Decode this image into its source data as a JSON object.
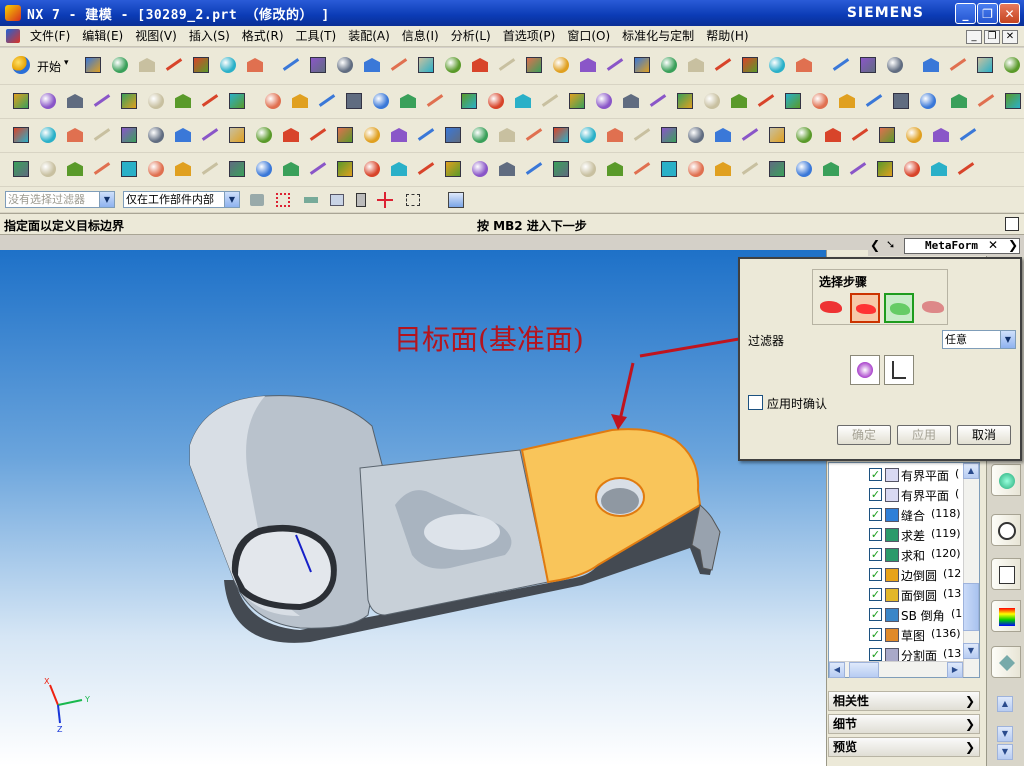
{
  "window": {
    "title": "NX 7 - 建模 - [30289_2.prt （修改的） ]",
    "brand": "SIEMENS",
    "minimize_label": "_",
    "restore_label": "❐",
    "close_label": "✕"
  },
  "menubar": {
    "items": [
      "文件(F)",
      "编辑(E)",
      "视图(V)",
      "插入(S)",
      "格式(R)",
      "工具(T)",
      "装配(A)",
      "信息(I)",
      "分析(L)",
      "首选项(P)",
      "窗口(O)",
      "标准化与定制",
      "帮助(H)"
    ]
  },
  "toolbar": {
    "start_label": "开始"
  },
  "filter_row": {
    "type_filter": "没有选择过滤器",
    "scope_filter": "仅在工作部件内部"
  },
  "status": {
    "prompt": "指定面以定义目标边界",
    "hint": "按 MB2 进入下一步"
  },
  "graphics": {
    "annotation": "目标面(基准面)",
    "triad_x": "X",
    "triad_y": "Y",
    "triad_z": "Z",
    "colors": {
      "target_face": "#f9c55a",
      "annotation_red": "#b4141e",
      "background_top": "#1e71c8"
    }
  },
  "tab": {
    "title": "MetaForm"
  },
  "dialog": {
    "steps_label": "选择步骤",
    "filter_label": "过滤器",
    "filter_value": "任意",
    "confirm_label": "应用时确认",
    "ok": "确定",
    "apply": "应用",
    "cancel": "取消"
  },
  "navigator": {
    "rows": [
      {
        "label": "有界平面",
        "num": "("
      },
      {
        "label": "有界平面",
        "num": "("
      },
      {
        "label": "缝合",
        "num": "(118)"
      },
      {
        "label": "求差",
        "num": "(119)"
      },
      {
        "label": "求和",
        "num": "(120)"
      },
      {
        "label": "边倒圆",
        "num": "(12"
      },
      {
        "label": "面倒圆",
        "num": "(13"
      },
      {
        "label": "SB 倒角",
        "num": "(1"
      },
      {
        "label": "草图",
        "num": "(136)"
      },
      {
        "label": "分割面",
        "num": "(13"
      }
    ],
    "sections": [
      "相关性",
      "细节",
      "预览"
    ]
  }
}
